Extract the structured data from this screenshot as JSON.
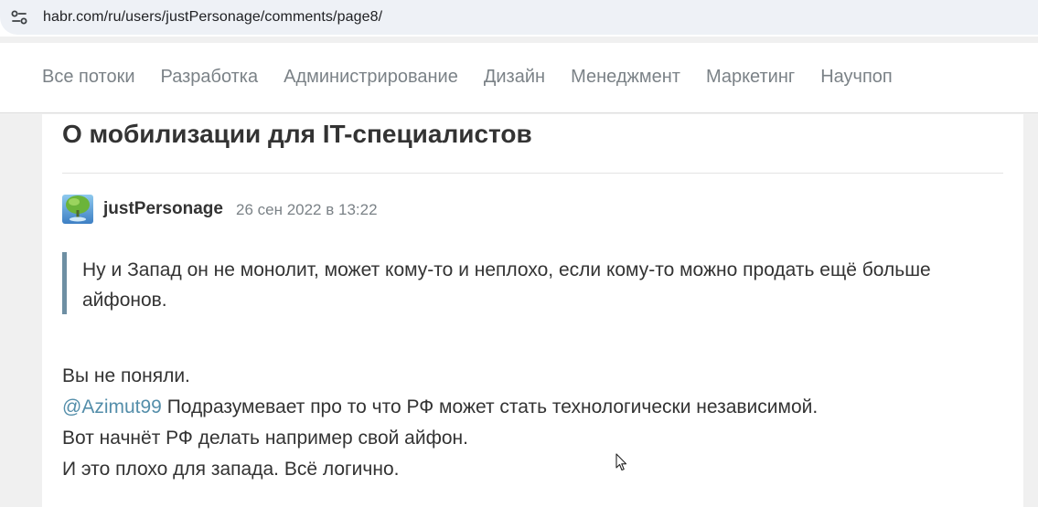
{
  "browser": {
    "url": "habr.com/ru/users/justPersonage/comments/page8/",
    "site_icon": "tune-icon"
  },
  "nav": {
    "items": [
      "Все потоки",
      "Разработка",
      "Администрирование",
      "Дизайн",
      "Менеджмент",
      "Маркетинг",
      "Научпоп"
    ]
  },
  "post": {
    "title": "О мобилизации для IT-специалистов"
  },
  "comment": {
    "author": "justPersonage",
    "date": "26 сен 2022 в 13:22",
    "quote": "Ну и Запад он не монолит, может кому-то и неплохо, если кому-то можно продать ещё больше айфонов.",
    "line1": "Вы не поняли.",
    "mention": "@Azimut99",
    "line2_rest": " Подразумевает про то что РФ может стать технологически независимой.",
    "line3": "Вот начнёт РФ делать например свой айфон.",
    "line4": "И это плохо для запада. Всё логично."
  },
  "colors": {
    "accent_link": "#548eaa",
    "quote_border": "#6e8fa3",
    "muted_text": "#7b8287"
  }
}
